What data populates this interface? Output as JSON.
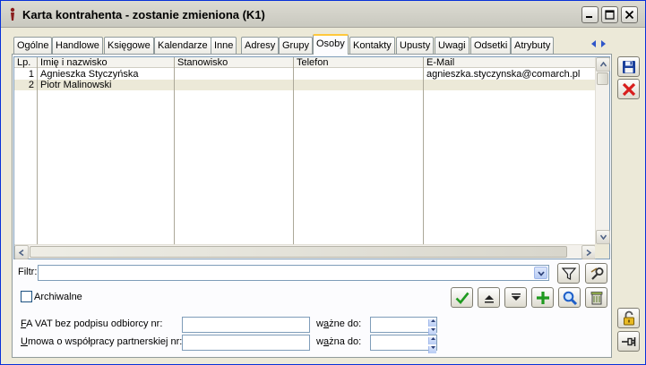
{
  "window": {
    "title": "Karta kontrahenta - zostanie zmieniona (K1)"
  },
  "tabs": [
    {
      "label": "Ogólne"
    },
    {
      "label": "Handlowe"
    },
    {
      "label": "Księgowe"
    },
    {
      "label": "Kalendarze"
    },
    {
      "label": "Inne"
    },
    {
      "label": "Adresy"
    },
    {
      "label": "Grupy"
    },
    {
      "label": "Osoby",
      "active": true
    },
    {
      "label": "Kontakty"
    },
    {
      "label": "Upusty"
    },
    {
      "label": "Uwagi"
    },
    {
      "label": "Odsetki"
    },
    {
      "label": "Atrybuty"
    }
  ],
  "grid": {
    "columns": [
      "Lp.",
      "Imię i nazwisko",
      "Stanowisko",
      "Telefon",
      "E-Mail"
    ],
    "rows": [
      {
        "lp": "1",
        "name": "Agnieszka Styczyńska",
        "position": "",
        "phone": "",
        "email": "agnieszka.styczynska@comarch.pl"
      },
      {
        "lp": "2",
        "name": "Piotr Malinowski",
        "position": "",
        "phone": "",
        "email": ""
      }
    ]
  },
  "filter": {
    "label": "Filtr:",
    "value": ""
  },
  "archive": {
    "label": "Archiwalne",
    "checked": false
  },
  "fields": {
    "fa_vat_label_u": "F",
    "fa_vat_label": "A VAT bez podpisu odbiorcy nr:",
    "fa_vat_value": "",
    "fa_vat_valid_label_pre": "w",
    "fa_vat_valid_label_u": "a",
    "fa_vat_valid_label": "żne do:",
    "fa_vat_valid_value": "",
    "umowa_label_u": "U",
    "umowa_label": "mowa o współpracy partnerskiej nr:",
    "umowa_value": "",
    "umowa_valid_label_pre": "w",
    "umowa_valid_label_u": "a",
    "umowa_valid_label": "żna do:",
    "umowa_valid_value": ""
  },
  "colors": {
    "accent_green": "#1f9a1f",
    "delete_red": "#d81e1e",
    "save_blue": "#1a3f9b",
    "tab_highlight": "#ffc83c"
  }
}
